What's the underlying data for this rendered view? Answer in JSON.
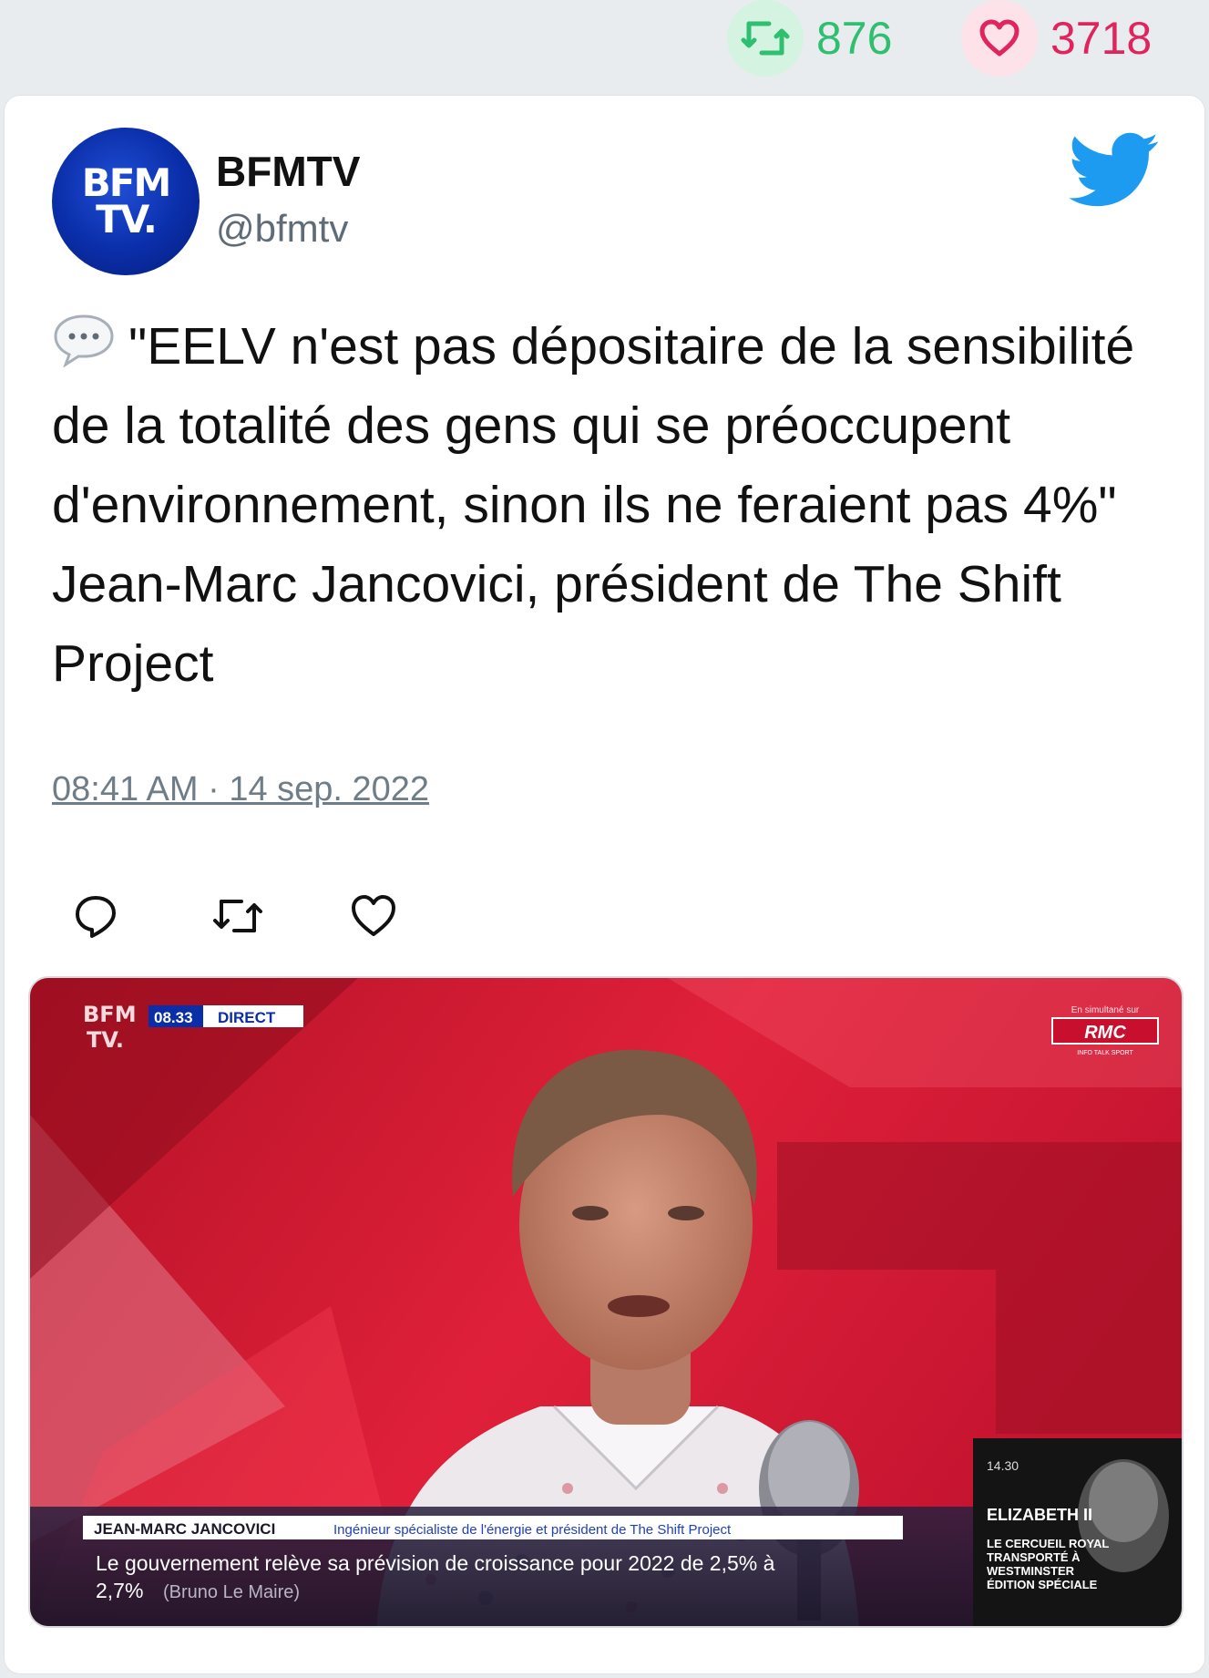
{
  "stats": {
    "retweets": "876",
    "likes": "3718",
    "retweet_icon": "retweet-icon",
    "like_icon": "heart-icon"
  },
  "tweet": {
    "author_name": "BFMTV",
    "author_handle": "@bfmtv",
    "avatar_text_line1": "BFM",
    "avatar_text_line2": "TV.",
    "text": "\"EELV n'est pas dépositaire de la sensibilité de la totalité des gens qui se préoccupent d'environnement, sinon ils ne feraient pas 4%\" Jean-Marc Jancovici, président de The Shift Project",
    "text_emoji": "speech-balloon-icon",
    "timestamp": "08:41 AM · 14 sep. 2022",
    "actions": [
      "reply-icon",
      "retweet-icon",
      "like-icon"
    ]
  },
  "media": {
    "channel_logo_line1": "BFM",
    "channel_logo_line2": "TV.",
    "time": "08.33",
    "live_label": "DIRECT",
    "simulcast_label": "En simultané sur",
    "simulcast_channel": "RMC",
    "simulcast_tagline": "INFO TALK SPORT",
    "lower_third_name": "JEAN-MARC JANCOVICI",
    "lower_third_title": "Ingénieur spécialiste de l'énergie et président de The Shift Project",
    "ticker_line1": "Le gouvernement relève sa prévision de croissance pour 2022 de 2,5% à",
    "ticker_line2_main": "2,7%",
    "ticker_line2_source": "(Bruno Le Maire)",
    "side_time": "14.30",
    "side_title": "ELIZABETH II",
    "side_line1": "LE CERCUEIL ROYAL",
    "side_line2": "TRANSPORTÉ À",
    "side_line3": "WESTMINSTER",
    "side_line4": "ÉDITION SPÉCIALE"
  },
  "colors": {
    "retweet": "#2fbf71",
    "like": "#e0245e",
    "twitter_blue": "#1d9bf0",
    "bfm_blue": "#0a2da8"
  }
}
